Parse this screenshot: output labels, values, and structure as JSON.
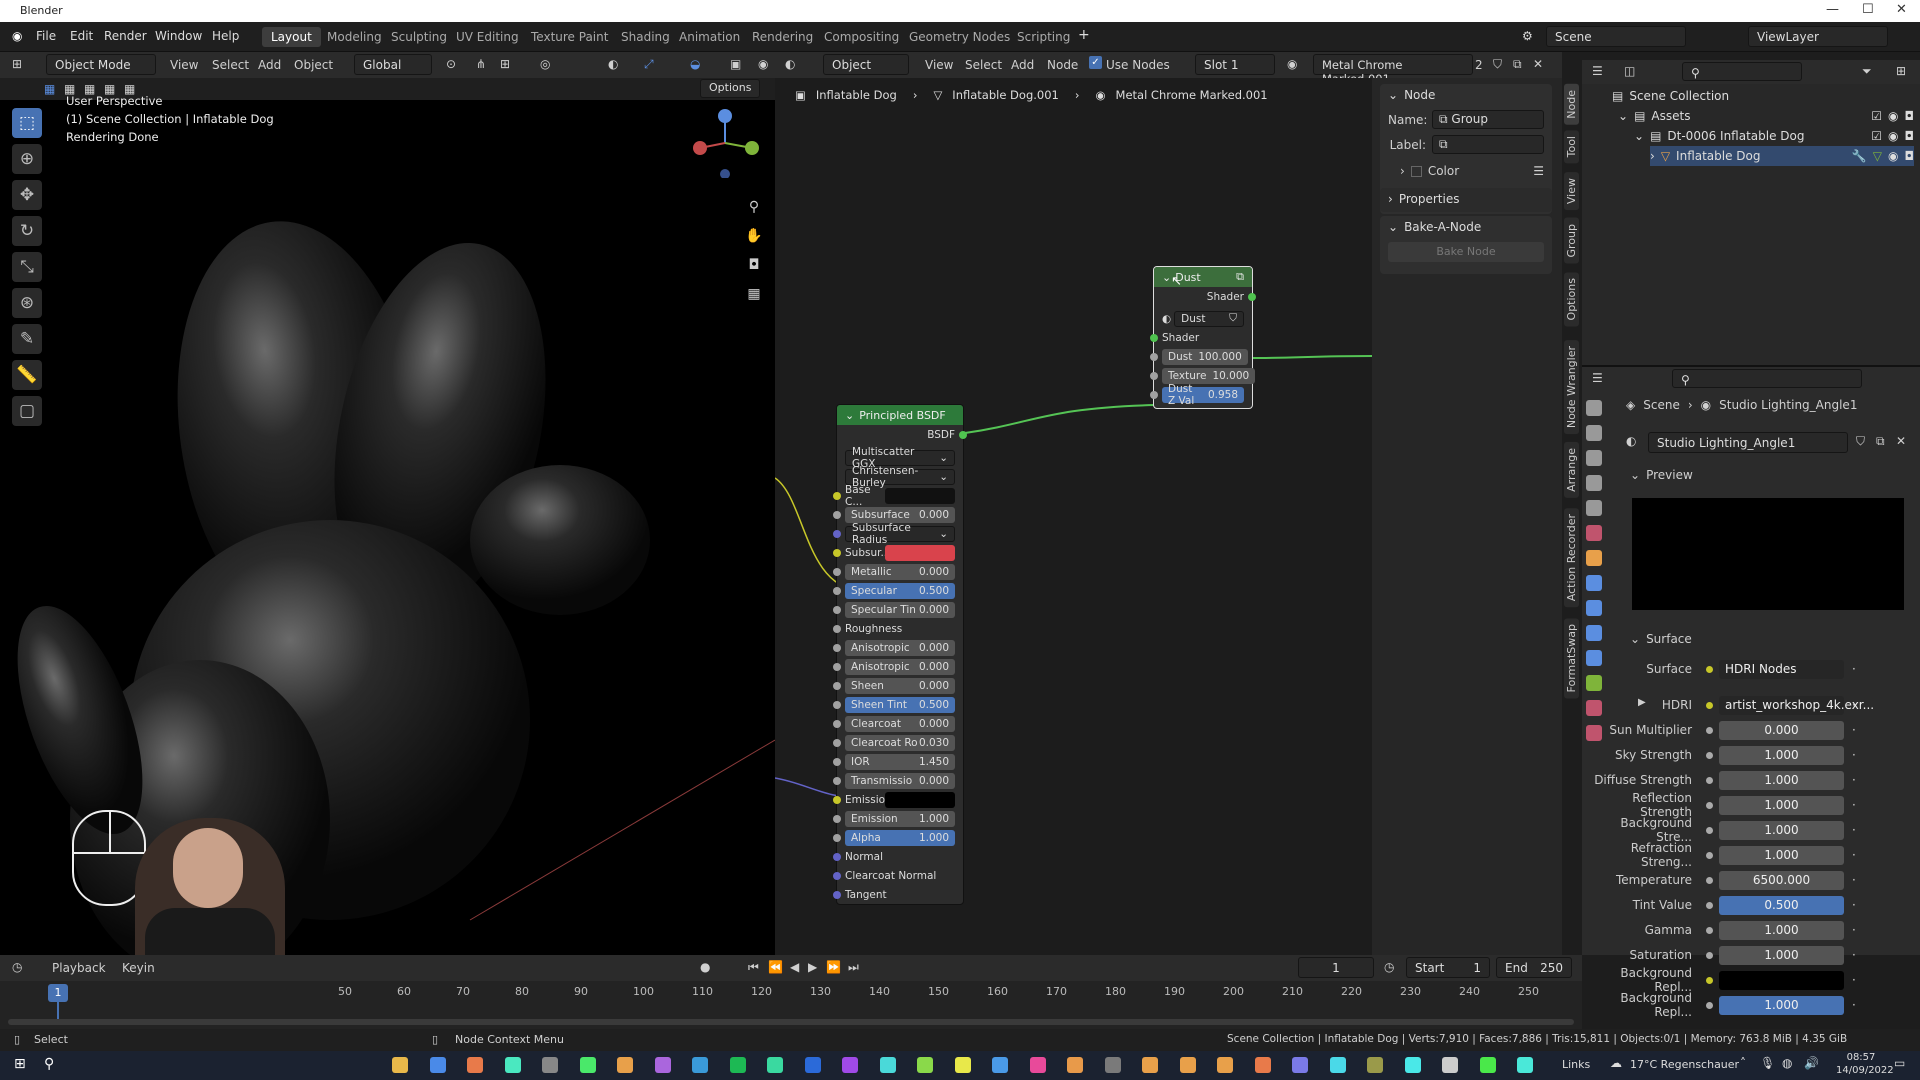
{
  "title": "Blender",
  "menu": [
    "File",
    "Edit",
    "Render",
    "Window",
    "Help"
  ],
  "workspaces": [
    "Layout",
    "Modeling",
    "Sculpting",
    "UV Editing",
    "Texture Paint",
    "Shading",
    "Animation",
    "Rendering",
    "Compositing",
    "Geometry Nodes",
    "Scripting"
  ],
  "scene_field": "Scene",
  "viewlayer_field": "ViewLayer",
  "viewport": {
    "mode": "Object Mode",
    "menus": [
      "View",
      "Select",
      "Add",
      "Object"
    ],
    "transform": "Global",
    "options": "Options",
    "overlay": [
      "User Perspective",
      "(1) Scene Collection | Inflatable Dog",
      "Rendering Done"
    ]
  },
  "node_editor": {
    "type": "Object",
    "menus": [
      "View",
      "Select",
      "Add",
      "Node"
    ],
    "use_nodes": "Use Nodes",
    "slot": "Slot 1",
    "material": "Metal Chrome Marked.001",
    "material_users": "2",
    "breadcrumb": [
      "Inflatable Dog",
      "Inflatable Dog.001",
      "Metal Chrome Marked.001"
    ]
  },
  "bsdf_node": {
    "title": "Principled BSDF",
    "output": "BSDF",
    "dropdowns": [
      "Multiscatter GGX",
      "Christensen-Burley"
    ],
    "fields": [
      {
        "label": "Base C...",
        "value": "",
        "kind": "color",
        "color": "#111111"
      },
      {
        "label": "Subsurface",
        "value": "0.000"
      },
      {
        "label": "Subsurface Radius",
        "value": "",
        "kind": "dd"
      },
      {
        "label": "Subsur...",
        "value": "",
        "kind": "color",
        "color": "#d9434c"
      },
      {
        "label": "Metallic",
        "value": "0.000"
      },
      {
        "label": "Specular",
        "value": "0.500",
        "kind": "blue"
      },
      {
        "label": "Specular Tin",
        "value": "0.000"
      },
      {
        "label": "Roughness",
        "value": "",
        "kind": "plain"
      },
      {
        "label": "Anisotropic",
        "value": "0.000"
      },
      {
        "label": "Anisotropic",
        "value": "0.000"
      },
      {
        "label": "Sheen",
        "value": "0.000"
      },
      {
        "label": "Sheen Tint",
        "value": "0.500",
        "kind": "blue"
      },
      {
        "label": "Clearcoat",
        "value": "0.000"
      },
      {
        "label": "Clearcoat Ro",
        "value": "0.030"
      },
      {
        "label": "IOR",
        "value": "1.450"
      },
      {
        "label": "Transmissio",
        "value": "0.000"
      },
      {
        "label": "Emission",
        "value": "",
        "kind": "color",
        "color": "#000000"
      },
      {
        "label": "Emission",
        "value": "1.000"
      },
      {
        "label": "Alpha",
        "value": "1.000",
        "kind": "blue"
      },
      {
        "label": "Normal",
        "value": "",
        "kind": "plain"
      },
      {
        "label": "Clearcoat Normal",
        "value": "",
        "kind": "plain"
      },
      {
        "label": "Tangent",
        "value": "",
        "kind": "plain"
      }
    ]
  },
  "dust_node": {
    "title": "Dust",
    "output": "Shader",
    "group": "Dust",
    "input": "Shader",
    "fields": [
      {
        "label": "Dust",
        "value": "100.000"
      },
      {
        "label": "Texture",
        "value": "10.000"
      },
      {
        "label": "Dust Z Val",
        "value": "0.958",
        "kind": "blue"
      }
    ]
  },
  "sidebar": {
    "node_panel": "Node",
    "name_label": "Name:",
    "name_value": "Group",
    "label_label": "Label:",
    "color": "Color",
    "properties": "Properties",
    "bake_panel": "Bake-A-Node",
    "bake_button": "Bake Node"
  },
  "tabs": [
    "Node",
    "Tool",
    "View",
    "Group",
    "Options",
    "Node Wrangler",
    "Arrange",
    "Action Recorder",
    "FormatSwap"
  ],
  "outliner": {
    "items": [
      "Scene Collection",
      "Assets",
      "Dt-0006 Inflatable Dog",
      "Inflatable Dog"
    ]
  },
  "properties": {
    "breadcrumb": [
      "Scene",
      "Studio Lighting_Angle1"
    ],
    "world": "Studio Lighting_Angle1",
    "preview": "Preview",
    "surface_panel": "Surface",
    "rows": [
      {
        "label": "Surface",
        "value": "HDRI Nodes",
        "kind": "dark"
      },
      {
        "label": "HDRI",
        "value": "artist_workshop_4k.exr...",
        "kind": "dark"
      },
      {
        "label": "Sun Multiplier",
        "value": "0.000"
      },
      {
        "label": "Sky Strength",
        "value": "1.000"
      },
      {
        "label": "Diffuse Strength",
        "value": "1.000"
      },
      {
        "label": "Reflection Strength",
        "value": "1.000"
      },
      {
        "label": "Background Stre...",
        "value": "1.000"
      },
      {
        "label": "Refraction Streng...",
        "value": "1.000"
      },
      {
        "label": "Temperature",
        "value": "6500.000"
      },
      {
        "label": "Tint Value",
        "value": "0.500",
        "kind": "blue"
      },
      {
        "label": "Gamma",
        "value": "1.000"
      },
      {
        "label": "Saturation",
        "value": "1.000"
      },
      {
        "label": "Background Repl...",
        "value": "",
        "kind": "black"
      },
      {
        "label": "Background Repl...",
        "value": "1.000",
        "kind": "blue"
      }
    ]
  },
  "timeline": {
    "menus": [
      "Playback",
      "Keyin"
    ],
    "current_frame": "1",
    "start_label": "Start",
    "start": "1",
    "end_label": "End",
    "end": "250",
    "ticks": [
      "50",
      "60",
      "70",
      "80",
      "90",
      "100",
      "110",
      "120",
      "130",
      "140",
      "150",
      "160",
      "170",
      "180",
      "190",
      "200",
      "210",
      "220",
      "230",
      "240",
      "250"
    ]
  },
  "status": {
    "left": "Select",
    "mid": "Node Context Menu",
    "right": "Scene Collection | Inflatable Dog | Verts:7,910 | Faces:7,886 | Tris:15,811 | Objects:0/1 | Memory: 763.8 MiB | 4.35 GiB"
  },
  "taskbar": {
    "links": "Links",
    "weather": "17°C Regenschauer",
    "time": "08:57",
    "date": "14/09/2022"
  }
}
